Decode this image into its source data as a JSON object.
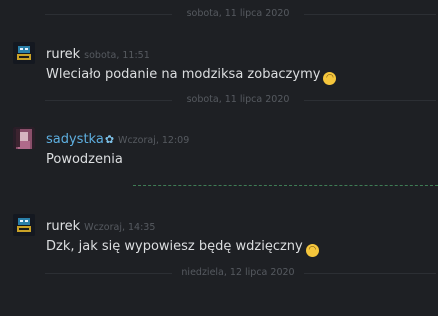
{
  "dividers": [
    {
      "label": "sobota, 11 lipca 2020"
    },
    {
      "label": "sobota, 11 lipca 2020"
    },
    {
      "label": "niedziela, 12 lipca 2020"
    }
  ],
  "messages": [
    {
      "author": "rurek",
      "time": "sobota, 11:51",
      "text": "Wleciało podanie na modziksa zobaczymy",
      "emoji": "upside-down-face"
    },
    {
      "author": "sadystka",
      "time": "Wczoraj, 12:09",
      "text": "Powodzenia",
      "author_badge": "flower-icon"
    },
    {
      "author": "rurek",
      "time": "Wczoraj, 14:35",
      "text": "Dzk, jak się wypowiesz będę wdzięczny",
      "emoji": "upside-down-face"
    }
  ],
  "colors": {
    "background": "#1e2024",
    "friend_name": "#5eafe0",
    "timestamp": "#565a60",
    "new_messages_separator": "#3f7d55"
  }
}
